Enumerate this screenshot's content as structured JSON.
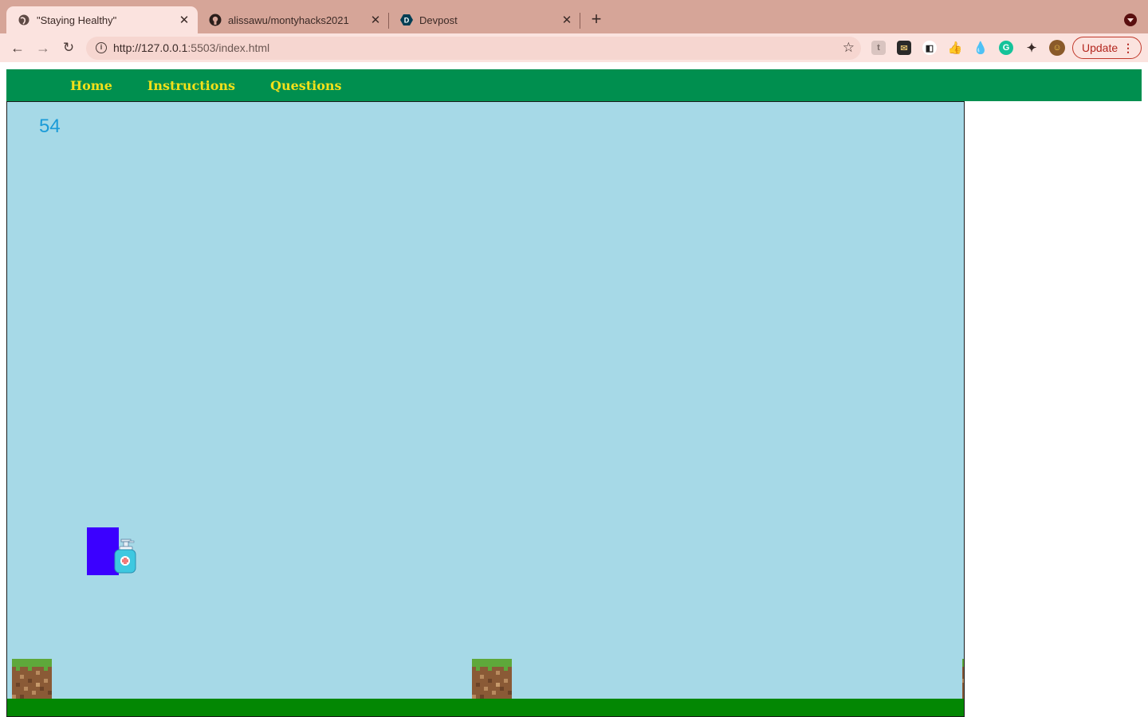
{
  "browser": {
    "tabs": [
      {
        "title": "\"Staying Healthy\"",
        "favicon": "globe-icon",
        "active": true
      },
      {
        "title": "alissawu/montyhacks2021",
        "favicon": "github-icon",
        "active": false
      },
      {
        "title": "Devpost",
        "favicon": "devpost-icon",
        "active": false
      }
    ],
    "new_tab_label": "+",
    "url_host": "http://127.0.0.1",
    "url_rest": ":5503/index.html",
    "update_label": "Update",
    "theme_color": "#d6a598"
  },
  "site": {
    "nav": [
      "Home",
      "Instructions",
      "Questions"
    ],
    "nav_color": "#008f4f",
    "nav_text_color": "#f2e01a"
  },
  "game": {
    "score": "54",
    "sky_color": "#a6d9e7",
    "player_color": "#3b00ff",
    "ground_color": "#038703",
    "collectible": "hand-sanitizer-icon",
    "obstacle": "dirt-block"
  }
}
